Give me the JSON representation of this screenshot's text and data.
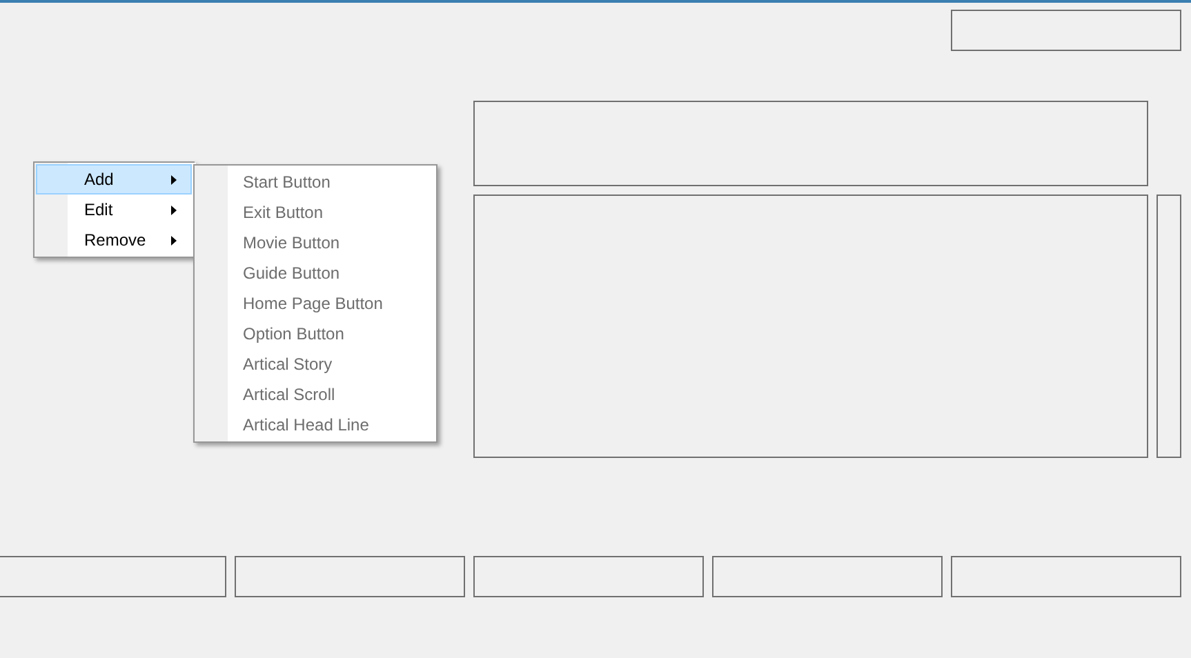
{
  "context_menu": {
    "items": [
      {
        "label": "Add",
        "selected": true
      },
      {
        "label": "Edit",
        "selected": false
      },
      {
        "label": "Remove",
        "selected": false
      }
    ]
  },
  "submenu": {
    "items": [
      {
        "label": "Start Button",
        "disabled": true
      },
      {
        "label": "Exit Button",
        "disabled": true
      },
      {
        "label": "Movie Button",
        "disabled": true
      },
      {
        "label": "Guide Button",
        "disabled": true
      },
      {
        "label": "Home Page Button",
        "disabled": true
      },
      {
        "label": "Option Button",
        "disabled": true
      },
      {
        "label": "Artical Story",
        "disabled": true
      },
      {
        "label": "Artical Scroll",
        "disabled": true
      },
      {
        "label": "Artical Head Line",
        "disabled": true
      }
    ]
  }
}
